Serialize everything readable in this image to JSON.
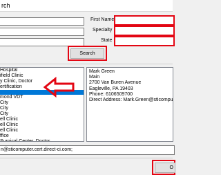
{
  "window": {
    "title": "rch"
  },
  "form": {
    "first_name_label": "First Name",
    "specialty_label": "Specialty",
    "state_label": "State",
    "search_label": "Search"
  },
  "results": {
    "items": [
      " Hospital",
      "ifield Clinic",
      "y Clinic, Doctor",
      "ertification",
      "",
      "mond VDT",
      "City",
      "City",
      "City",
      "ell Clinic",
      "ell Clinic",
      "ell Clinic",
      "ffice",
      "Surgical Center, Doctor"
    ],
    "selected_index": 4
  },
  "details": {
    "lines": [
      "Mark Green",
      "Main",
      "2700 Van Buren Avenue",
      "Eagleville, PA 19403",
      "Phone: 6106509700",
      "Direct Address: Mark.Green@sticomputer.cert.direct-"
    ]
  },
  "footer": {
    "direct_address_value": "n@sticomputer.cert.direct-ci.com;",
    "ok_label": "O"
  },
  "colors": {
    "highlight_red": "#e30613",
    "selection_blue": "#0078d7"
  }
}
